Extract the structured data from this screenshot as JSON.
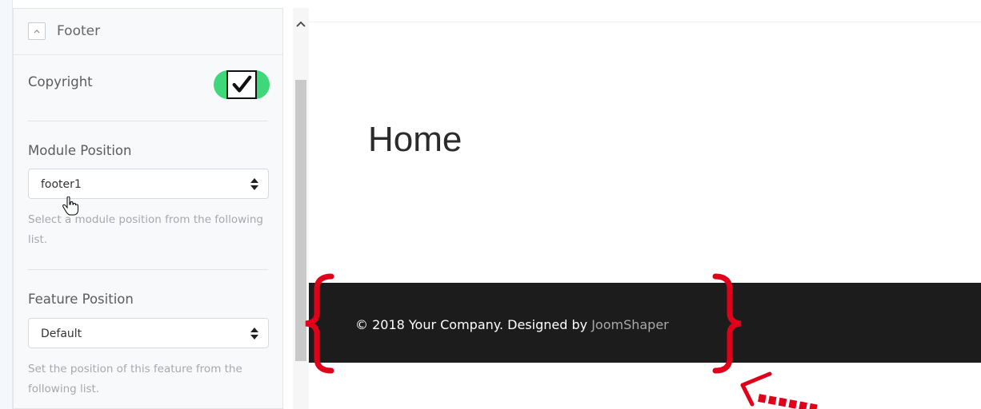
{
  "settings_panel": {
    "title": "Footer",
    "copyright": {
      "label": "Copyright",
      "enabled": true
    },
    "module_position": {
      "label": "Module Position",
      "value": "footer1",
      "help": "Select a module position from the following list."
    },
    "feature_position": {
      "label": "Feature Position",
      "value": "Default",
      "help": "Set the position of this feature from the following list."
    }
  },
  "preview": {
    "page_title": "Home",
    "footer": {
      "copyright_text": "© 2018 Your Company. Designed by ",
      "link_text": "JoomShaper",
      "background": "#1c1c1c"
    }
  },
  "colors": {
    "toggle_on": "#3ed87a",
    "annotation": "#e0001a"
  },
  "icons": {
    "collapse": "chevron-up-icon",
    "toggle_check": "check-icon",
    "select_arrows": "sort-icon",
    "scroll_up": "chevron-up-icon",
    "cursor": "hand-pointer-icon"
  }
}
